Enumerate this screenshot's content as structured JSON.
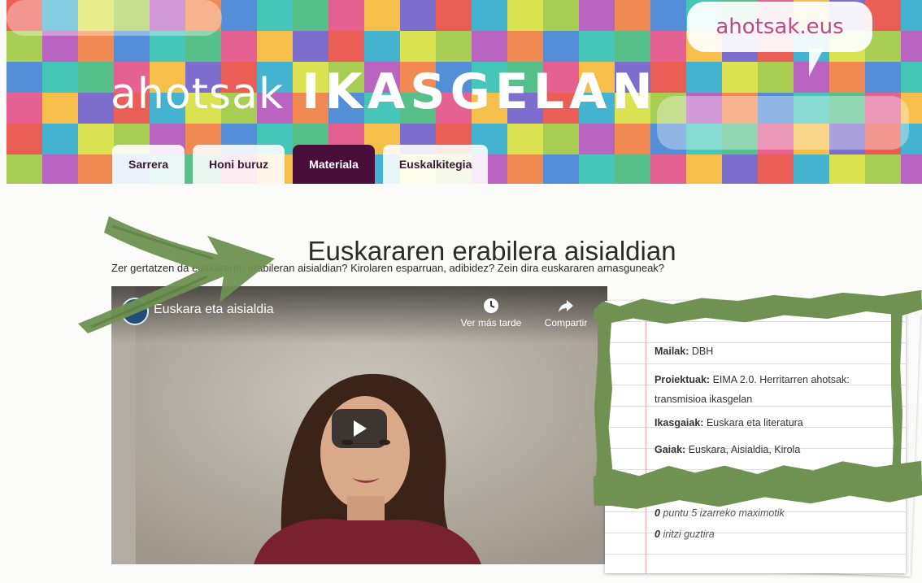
{
  "header": {
    "site_title_lower": "ahotsak",
    "site_title_upper": "IKASGELAN",
    "brand": "ahotsak.eus"
  },
  "tabs": [
    {
      "label": "Sarrera",
      "active": false
    },
    {
      "label": "Honi buruz",
      "active": false
    },
    {
      "label": "Materiala",
      "active": true
    },
    {
      "label": "Euskalkitegia",
      "active": false
    }
  ],
  "main": {
    "title": "Euskararen erabilera aisialdian",
    "intro": "Zer gertatzen da euskararen erabileran aisialdian? Kirolaren esparruan, adibidez? Zein dira euskararen arnasguneak?"
  },
  "video": {
    "title": "Euskara eta aisialdia",
    "watch_later": "Ver más tarde",
    "share": "Compartir"
  },
  "info": {
    "mailak": {
      "label": "Mailak:",
      "value": "DBH"
    },
    "proiektuak": {
      "label": "Proiektuak:",
      "value": "EIMA 2.0. Herritarren ahotsak: transmisioa ikasgelan"
    },
    "ikasgaiak": {
      "label": "Ikasgaiak:",
      "value": "Euskara eta literatura"
    },
    "gaiak": {
      "label": "Gaiak:",
      "value": "Euskara, Aisialdia, Kirola"
    },
    "rating_count": "0",
    "rating_text": "puntu 5 izarreko maximotik",
    "reviews_count": "0",
    "reviews_text": "iritzi guztira"
  },
  "colors": {
    "active_tab": "#4a0e3a",
    "brand_text": "#c04a86",
    "highlight_green": "#6f9151"
  }
}
